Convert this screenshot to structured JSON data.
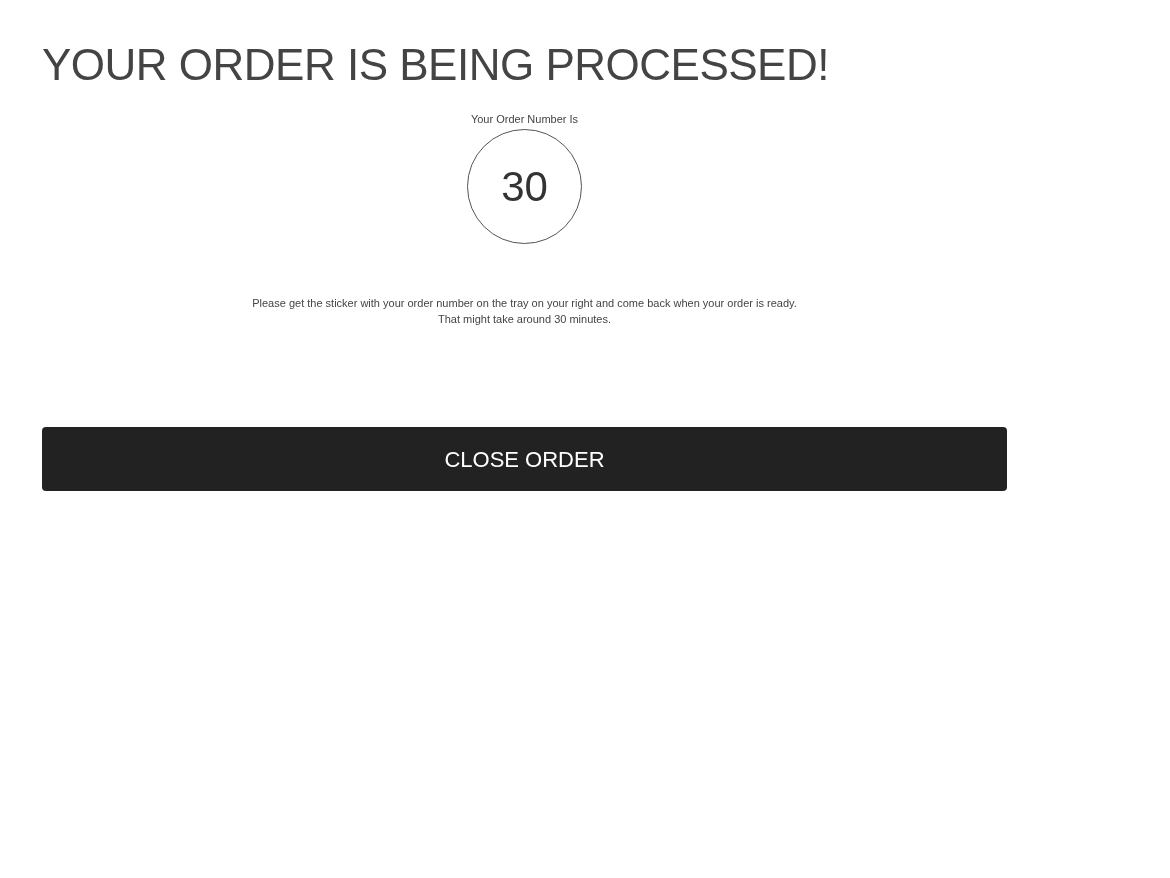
{
  "heading": "YOUR ORDER IS BEING PROCESSED!",
  "order_number_label": "Your Order Number Is",
  "order_number": "30",
  "message_lines": [
    "Please get the sticker with your order number on the tray on your right and come back when your order is ready.",
    "That might take around 30 minutes."
  ],
  "close_button": "CLOSE ORDER"
}
